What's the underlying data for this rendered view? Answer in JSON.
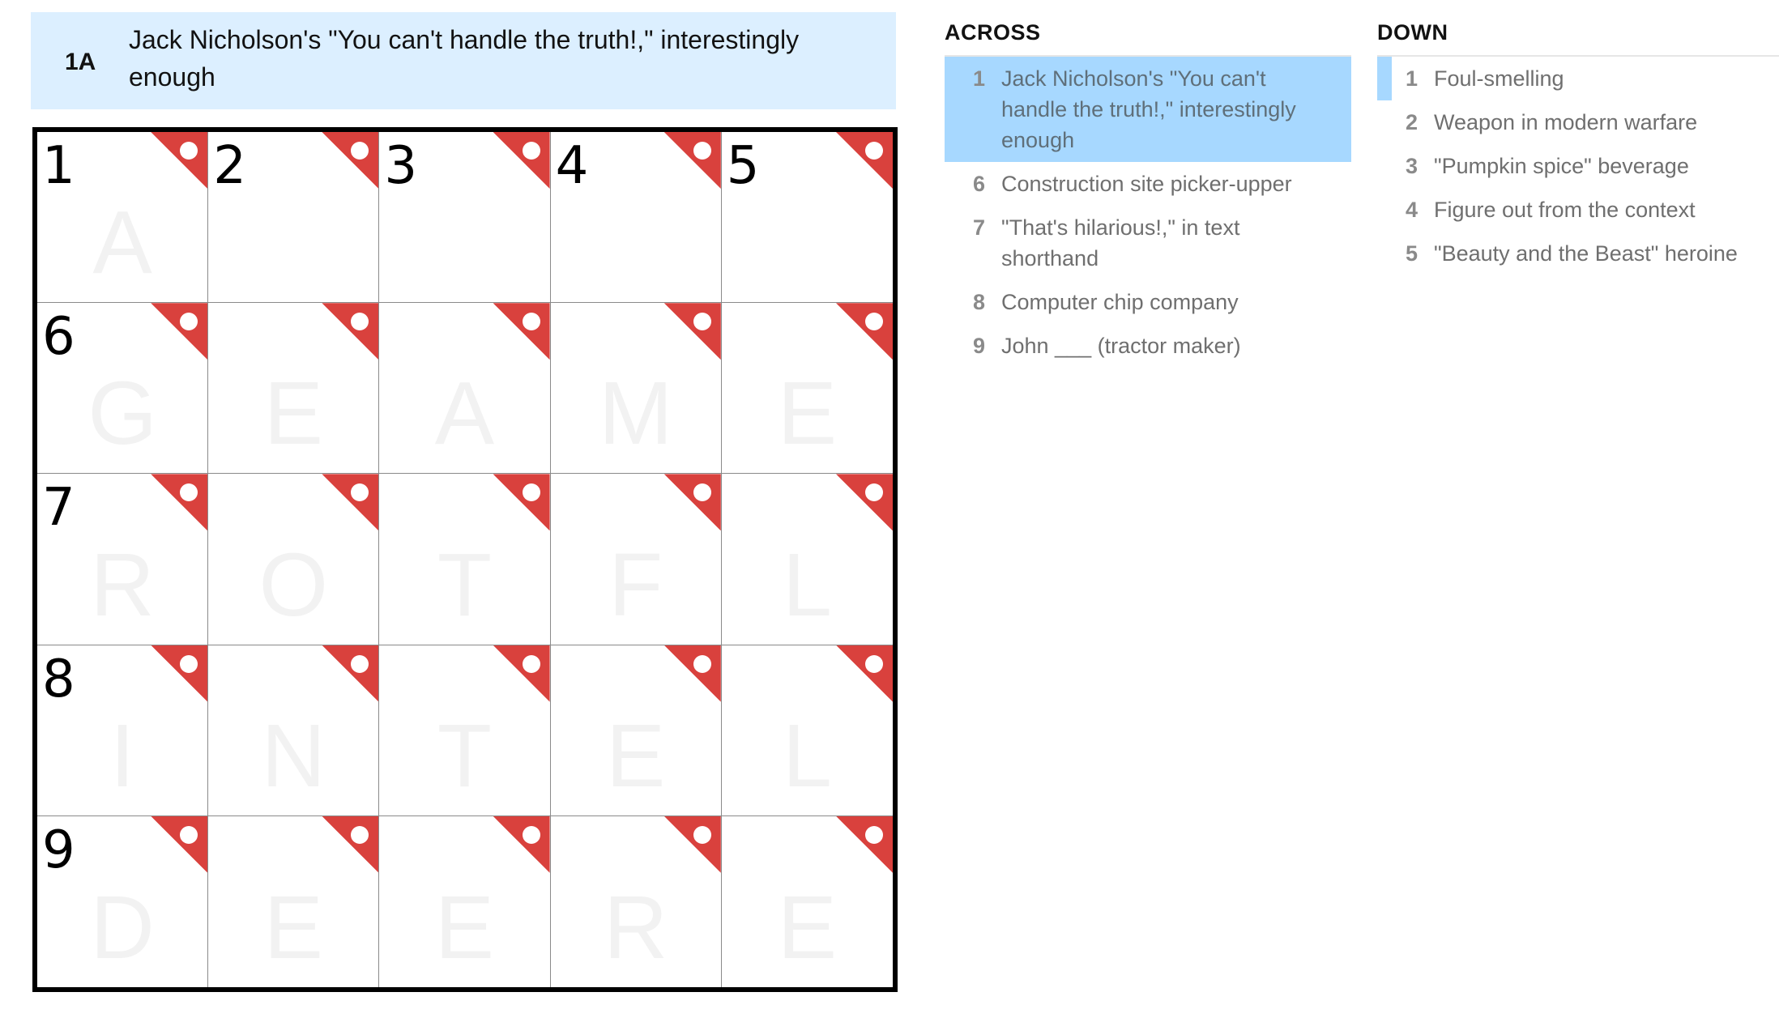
{
  "clue_bar": {
    "number": "1A",
    "text": "Jack Nicholson's \"You can't handle the truth!,\" interestingly enough"
  },
  "grid": {
    "rows": 5,
    "cols": 5,
    "cells": [
      {
        "number": "1",
        "letter": "A"
      },
      {
        "number": "2",
        "letter": ""
      },
      {
        "number": "3",
        "letter": ""
      },
      {
        "number": "4",
        "letter": ""
      },
      {
        "number": "5",
        "letter": ""
      },
      {
        "number": "6",
        "letter": "G"
      },
      {
        "number": "",
        "letter": "E"
      },
      {
        "number": "",
        "letter": "A"
      },
      {
        "number": "",
        "letter": "M"
      },
      {
        "number": "",
        "letter": "E"
      },
      {
        "number": "7",
        "letter": "R"
      },
      {
        "number": "",
        "letter": "O"
      },
      {
        "number": "",
        "letter": "T"
      },
      {
        "number": "",
        "letter": "F"
      },
      {
        "number": "",
        "letter": "L"
      },
      {
        "number": "8",
        "letter": "I"
      },
      {
        "number": "",
        "letter": "N"
      },
      {
        "number": "",
        "letter": "T"
      },
      {
        "number": "",
        "letter": "E"
      },
      {
        "number": "",
        "letter": "L"
      },
      {
        "number": "9",
        "letter": "D"
      },
      {
        "number": "",
        "letter": "E"
      },
      {
        "number": "",
        "letter": "E"
      },
      {
        "number": "",
        "letter": "R"
      },
      {
        "number": "",
        "letter": "E"
      }
    ],
    "flag_color": "#d9413d"
  },
  "across": {
    "title": "ACROSS",
    "clues": [
      {
        "num": "1",
        "text": "Jack Nicholson's \"You can't handle the truth!,\" interestingly enough",
        "selected": true
      },
      {
        "num": "6",
        "text": "Construction site picker-upper"
      },
      {
        "num": "7",
        "text": "\"That's hilarious!,\" in text shorthand"
      },
      {
        "num": "8",
        "text": "Computer chip company"
      },
      {
        "num": "9",
        "text": "John ___ (tractor maker)"
      }
    ]
  },
  "down": {
    "title": "DOWN",
    "clues": [
      {
        "num": "1",
        "text": "Foul-smelling",
        "related": true
      },
      {
        "num": "2",
        "text": "Weapon in modern warfare"
      },
      {
        "num": "3",
        "text": "\"Pumpkin spice\" beverage"
      },
      {
        "num": "4",
        "text": "Figure out from the context"
      },
      {
        "num": "5",
        "text": "\"Beauty and the Beast\" heroine"
      }
    ]
  },
  "colors": {
    "clue_bar_bg": "#dcefff",
    "selected_clue_bg": "#a7d8ff",
    "check_flag": "#d9413d"
  }
}
